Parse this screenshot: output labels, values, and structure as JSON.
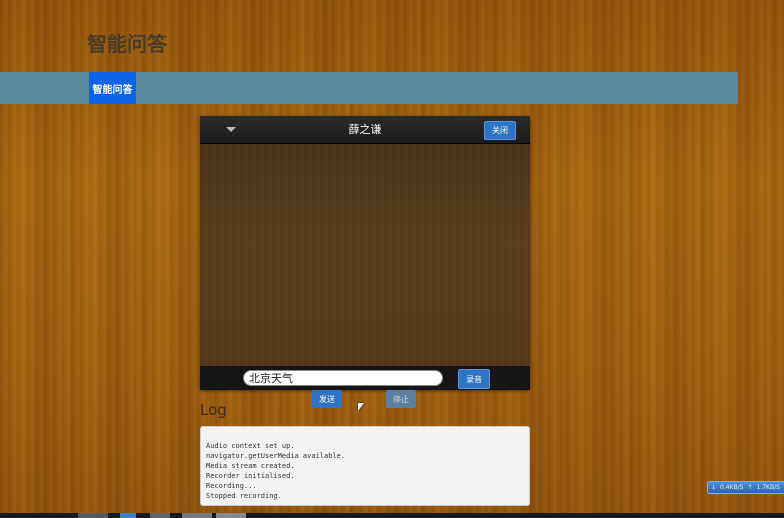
{
  "site": {
    "title": "智能问答"
  },
  "nav": {
    "active_label": "智能问答"
  },
  "chat": {
    "title": "薛之谦",
    "close_label": "关闭",
    "input_value": "北京天气",
    "voice_label": "录音"
  },
  "actions": {
    "send_label": "发送",
    "stop_label": "停止"
  },
  "log": {
    "heading": "Log",
    "lines": [
      "Audio context set up.",
      "navigator.getUserMedia available.",
      "Media stream created.",
      "Recorder initialised.",
      "Recording...",
      "Stopped recording."
    ]
  },
  "corner_widget": {
    "down_text": "0.4KB/S",
    "up_text": "1.7KB/S"
  },
  "icons": {
    "dropdown": "chevron-down-icon",
    "cursor": "mouse-cursor-icon",
    "down_arrow": "arrow-down-icon",
    "up_arrow": "arrow-up-icon"
  },
  "colors": {
    "nav_active": "#0b63e6",
    "navbar": "#5a8aa0",
    "primary_button": "#2f73c4",
    "stop_button": "#5f7fa0"
  }
}
